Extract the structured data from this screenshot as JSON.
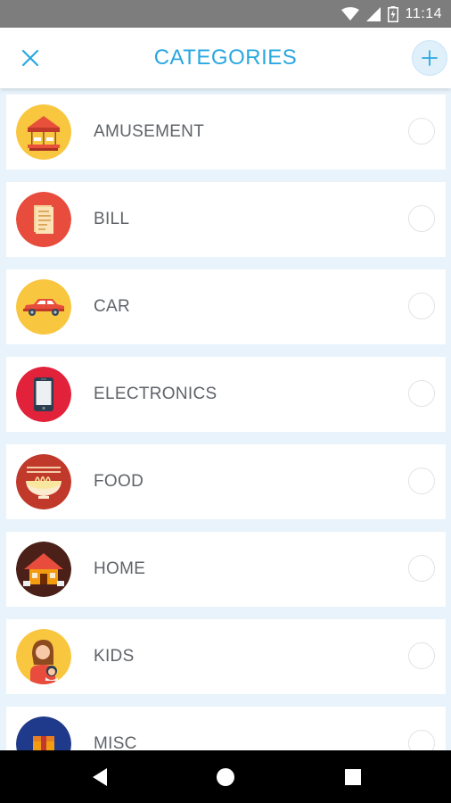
{
  "status_bar": {
    "time": "11:14",
    "icons": [
      "wifi-icon",
      "signal-icon",
      "battery-icon"
    ]
  },
  "app_bar": {
    "title": "CATEGORIES",
    "close_icon": "close-icon",
    "add_icon": "plus-icon",
    "accent_color": "#29a8e0"
  },
  "categories": [
    {
      "label": "AMUSEMENT",
      "icon": "carousel-icon",
      "selected": false
    },
    {
      "label": "BILL",
      "icon": "bill-document-icon",
      "selected": false
    },
    {
      "label": "CAR",
      "icon": "car-icon",
      "selected": false
    },
    {
      "label": "ELECTRONICS",
      "icon": "smartphone-icon",
      "selected": false
    },
    {
      "label": "FOOD",
      "icon": "noodle-bowl-icon",
      "selected": false
    },
    {
      "label": "HOME",
      "icon": "house-icon",
      "selected": false
    },
    {
      "label": "KIDS",
      "icon": "mother-baby-icon",
      "selected": false
    },
    {
      "label": "MISC",
      "icon": "box-icon",
      "selected": false
    }
  ],
  "nav_bar": {
    "back_icon": "back-triangle-icon",
    "home_icon": "home-circle-icon",
    "recents_icon": "recents-square-icon"
  }
}
